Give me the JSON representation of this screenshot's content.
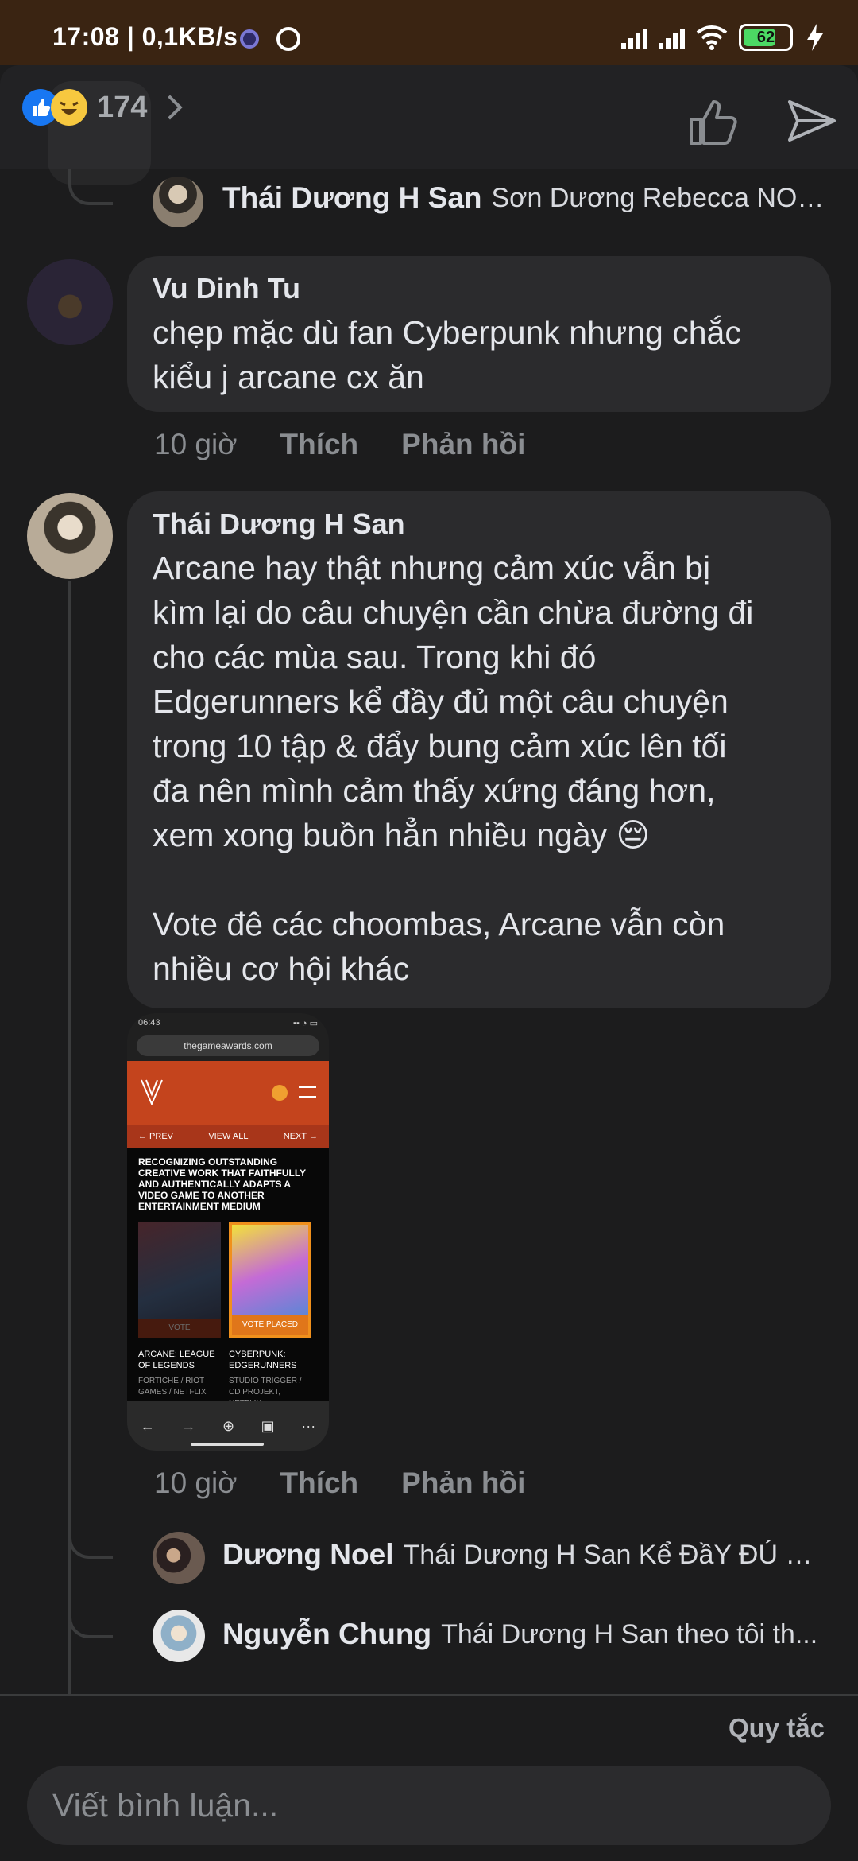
{
  "status_bar": {
    "time_speed": "17:08 | 0,1KB/s",
    "battery": "62"
  },
  "header": {
    "reaction_count": "174"
  },
  "replies_top": [
    {
      "name": "Thái Dương H San",
      "text": "Sơn Dương Rebecca NOO..."
    }
  ],
  "comments": [
    {
      "name": "Vu Dinh Tu",
      "text": "chẹp mặc dù fan Cyberpunk nhưng chắc\nkiểu j arcane cx ăn",
      "time": "10 giờ",
      "like": "Thích",
      "reply": "Phản hồi"
    },
    {
      "name": "Thái Dương H San",
      "text": "Arcane hay thật nhưng cảm xúc vẫn bị\nkìm lại do câu chuyện cần chừa đường đi\ncho các mùa sau. Trong khi đó\nEdgerunners kể đầy đủ một câu chuyện\ntrong 10 tập & đẩy bung cảm xúc lên tối\nđa nên mình cảm thấy xứng đáng hơn,\nxem xong buồn hẳn nhiều ngày 😔\n\nVote đê các choombas, Arcane vẫn còn\nnhiều cơ hội khác",
      "time": "10 giờ",
      "like": "Thích",
      "reply": "Phản hồi"
    }
  ],
  "attachment": {
    "time": "06:43",
    "url": "thegameawards.com",
    "prev": "← PREV",
    "view_all": "VIEW ALL",
    "next": "NEXT →",
    "headline": "Recognizing outstanding creative work that faithfully and authentically adapts a video game to another entertainment medium",
    "card1_button": "VOTE",
    "card2_button": "VOTE PLACED",
    "card1_title": "ARCANE: LEAGUE OF LEGENDS",
    "card1_sub": "FORTICHE / RIOT GAMES / NETFLIX",
    "card2_title": "CYBERPUNK: EDGERUNNERS",
    "card2_sub": "STUDIO TRIGGER / CD PROJEKT, NETFLIX"
  },
  "replies_bottom": [
    {
      "name": "Dương Noel",
      "text": "Thái Dương H San Kể ĐầY ĐÚ m..."
    },
    {
      "name": "Nguyễn Chung",
      "text": "Thái Dương H San theo tôi th..."
    }
  ],
  "footer": {
    "rules": "Quy tắc",
    "placeholder": "Viết bình luận..."
  },
  "colors": {
    "status_bar": "#3a2412",
    "background": "#1c1c1d",
    "bubble": "#2b2b2d",
    "like_blue": "#1877f2",
    "haha_yellow": "#f7c83f"
  }
}
